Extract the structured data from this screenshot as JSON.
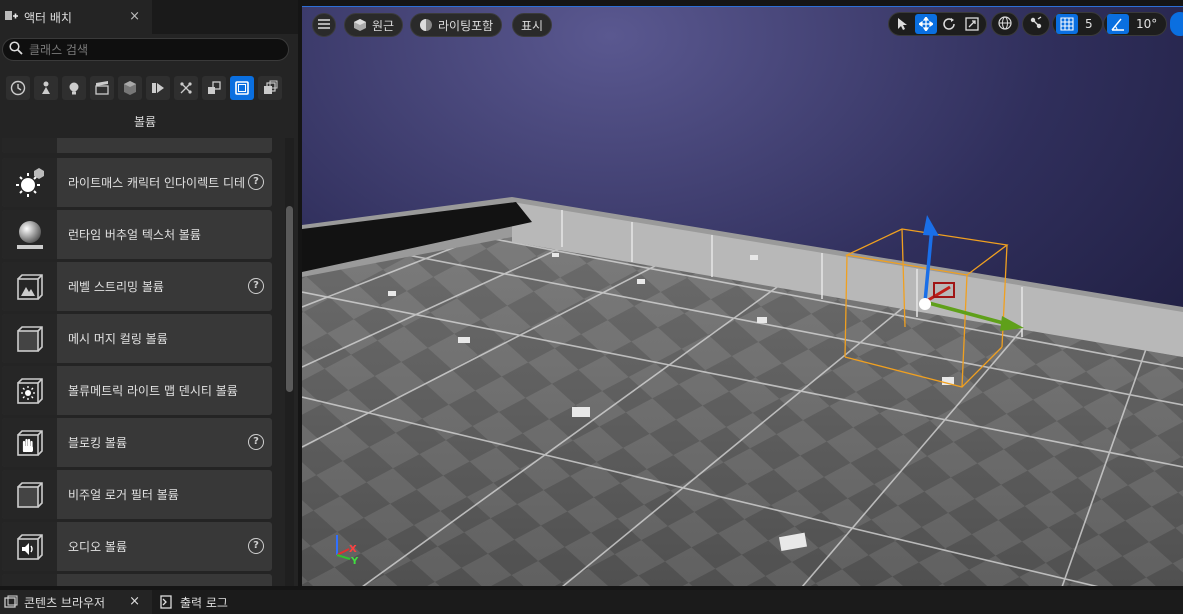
{
  "left_panel": {
    "tab_title": "액터 배치",
    "tab_close": "×",
    "search": {
      "placeholder": "클래스 검색"
    },
    "category_title": "볼륨",
    "categories": [
      "recent-icon",
      "basic-icon",
      "lights-icon",
      "cinematic-icon",
      "visual-effects-icon",
      "geometry-icon",
      "volumes-icon",
      "all-classes-icon",
      "volume-icon",
      "more-icon"
    ],
    "active_category": 8,
    "items": [
      {
        "label": "라이트매스 캐릭터 인다이렉트 디테일 볼륨",
        "help": "?"
      },
      {
        "label": "런타임 버추얼 텍스처 볼륨",
        "help": ""
      },
      {
        "label": "레벨 스트리밍 볼륨",
        "help": "?"
      },
      {
        "label": "메시 머지 컬링 볼륨",
        "help": ""
      },
      {
        "label": "볼류메트릭 라이트 맵 덴시티 볼륨",
        "help": ""
      },
      {
        "label": "블로킹 볼륨",
        "help": "?"
      },
      {
        "label": "비주얼 로거 필터 볼륨",
        "help": ""
      },
      {
        "label": "오디오 볼륨",
        "help": "?"
      }
    ]
  },
  "viewport": {
    "menu_icon": "hamburger-icon",
    "perspective_label": "원근",
    "lighting_label": "라이팅포함",
    "show_label": "표시",
    "grid_snap_value": "5",
    "rotation_snap_value": "10°",
    "axis_labels": {
      "x": "X",
      "y": "Y",
      "z": "Z"
    },
    "accent_color": "#0a6fe0",
    "selection_color": "#f0a020"
  },
  "bottom_bar": {
    "content_browser_label": "콘텐츠 브라우저",
    "content_browser_close": "×",
    "output_log_label": "출력 로그"
  }
}
